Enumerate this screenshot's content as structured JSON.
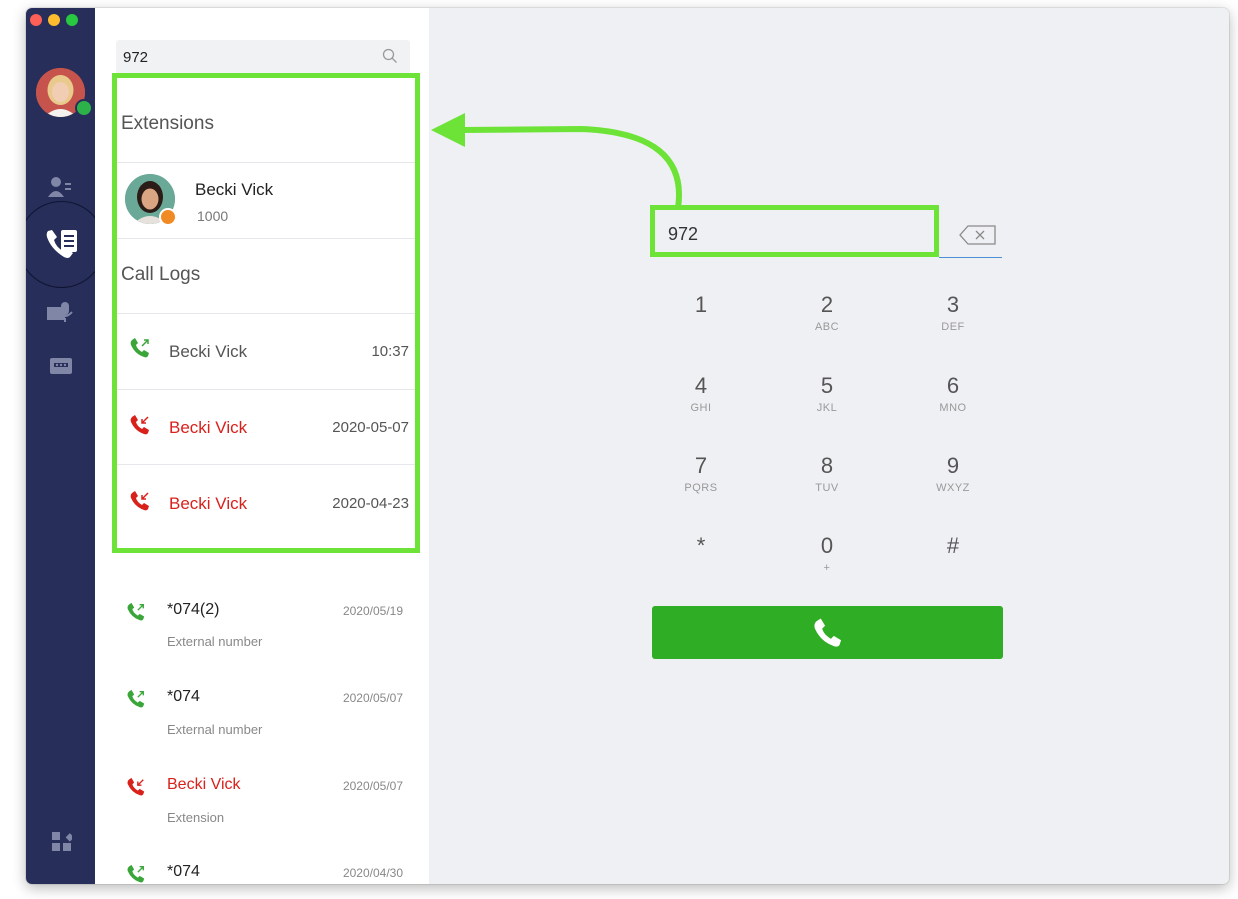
{
  "search": {
    "value": "972"
  },
  "extensions": {
    "heading": "Extensions",
    "items": [
      {
        "name": "Becki Vick",
        "number": "1000"
      }
    ]
  },
  "call_logs": {
    "heading": "Call Logs",
    "items": [
      {
        "name": "Becki Vick",
        "time": "10:37",
        "type": "outgoing",
        "color": "#555555"
      },
      {
        "name": "Becki Vick",
        "time": "2020-05-07",
        "type": "missed",
        "color": "#d9211c"
      },
      {
        "name": "Becki Vick",
        "time": "2020-04-23",
        "type": "missed",
        "color": "#d9211c"
      }
    ]
  },
  "recent": [
    {
      "title": "*074(2)",
      "date": "2020/05/19",
      "subtitle": "External number",
      "type": "outgoing"
    },
    {
      "title": "*074",
      "date": "2020/05/07",
      "subtitle": "External number",
      "type": "outgoing"
    },
    {
      "title": "Becki Vick",
      "date": "2020/05/07",
      "subtitle": "Extension",
      "type": "missed"
    },
    {
      "title": "*074",
      "date": "2020/04/30",
      "subtitle": "",
      "type": "outgoing"
    }
  ],
  "dialer": {
    "value": "972",
    "keys": [
      {
        "digit": "1",
        "letters": ""
      },
      {
        "digit": "2",
        "letters": "ABC"
      },
      {
        "digit": "3",
        "letters": "DEF"
      },
      {
        "digit": "4",
        "letters": "GHI"
      },
      {
        "digit": "5",
        "letters": "JKL"
      },
      {
        "digit": "6",
        "letters": "MNO"
      },
      {
        "digit": "7",
        "letters": "PQRS"
      },
      {
        "digit": "8",
        "letters": "TUV"
      },
      {
        "digit": "9",
        "letters": "WXYZ"
      },
      {
        "digit": "*",
        "letters": ""
      },
      {
        "digit": "0",
        "letters": "+"
      },
      {
        "digit": "#",
        "letters": ""
      }
    ]
  },
  "colors": {
    "nav_bg": "#262e59",
    "highlight": "#6ee337",
    "call_green": "#2fad24",
    "missed_red": "#d9211c",
    "outgoing_green": "#3aa63a"
  },
  "icons": {
    "nav": [
      "contacts-icon",
      "call-log-icon",
      "voicemail-icon",
      "chat-icon",
      "apps-icon"
    ],
    "backspace": "backspace-icon",
    "search": "search-icon",
    "call": "phone-icon"
  }
}
